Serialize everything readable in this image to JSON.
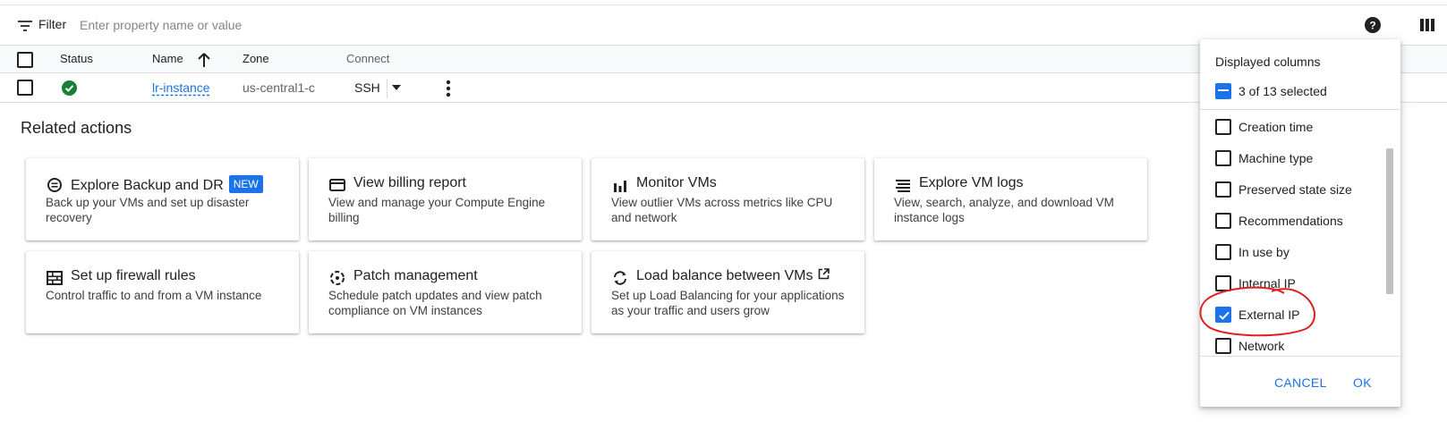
{
  "filter": {
    "label": "Filter",
    "placeholder": "Enter property name or value"
  },
  "table": {
    "headers": {
      "status": "Status",
      "name": "Name",
      "zone": "Zone",
      "connect": "Connect"
    },
    "rows": [
      {
        "status": "running",
        "name": "lr-instance",
        "zone": "us-central1-c",
        "connect": "SSH"
      }
    ]
  },
  "related": {
    "title": "Related actions",
    "cards": [
      {
        "icon": "backup-icon",
        "title": "Explore Backup and DR",
        "badge": "NEW",
        "description": "Back up your VMs and set up disaster recovery"
      },
      {
        "icon": "billing-icon",
        "title": "View billing report",
        "description": "View and manage your Compute Engine billing"
      },
      {
        "icon": "bar-chart-icon",
        "title": "Monitor VMs",
        "description": "View outlier VMs across metrics like CPU and network"
      },
      {
        "icon": "logs-icon",
        "title": "Explore VM logs",
        "description": "View, search, analyze, and download VM instance logs"
      },
      {
        "icon": "firewall-icon",
        "title": "Set up firewall rules",
        "description": "Control traffic to and from a VM instance"
      },
      {
        "icon": "patch-icon",
        "title": "Patch management",
        "description": "Schedule patch updates and view patch compliance on VM instances"
      },
      {
        "icon": "load-balance-icon",
        "title": "Load balance between VMs",
        "description": "Set up Load Balancing for your applications as your traffic and users grow"
      }
    ]
  },
  "columns_panel": {
    "title": "Displayed columns",
    "selected_text": "3 of 13 selected",
    "items": [
      {
        "label": "Creation time",
        "checked": false
      },
      {
        "label": "Machine type",
        "checked": false
      },
      {
        "label": "Preserved state size",
        "checked": false
      },
      {
        "label": "Recommendations",
        "checked": false
      },
      {
        "label": "In use by",
        "checked": false
      },
      {
        "label": "Internal IP",
        "checked": false
      },
      {
        "label": "External IP",
        "checked": true
      },
      {
        "label": "Network",
        "checked": false
      }
    ],
    "cancel_label": "CANCEL",
    "ok_label": "OK"
  },
  "colors": {
    "accent": "#1a73e8",
    "success": "#188038",
    "annotation": "#e0201f"
  }
}
